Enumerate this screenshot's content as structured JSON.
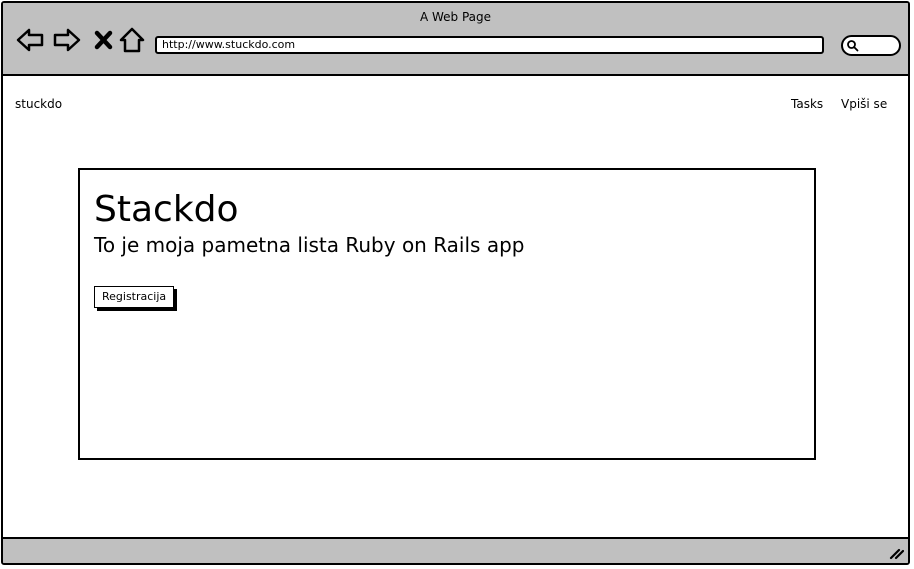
{
  "window": {
    "title": "A Web Page"
  },
  "browser": {
    "url": "http://www.stuckdo.com",
    "icons": [
      "back-arrow-icon",
      "forward-arrow-icon",
      "close-x-icon",
      "home-icon",
      "search-icon",
      "resize-grip-icon"
    ]
  },
  "navbar": {
    "brand": "stuckdo",
    "links": [
      {
        "label": "Tasks"
      },
      {
        "label": "Vpiši se"
      }
    ]
  },
  "hero": {
    "title": "Stackdo",
    "subtitle": "To je moja pametna lista Ruby on Rails app",
    "button_label": "Registracija"
  },
  "colors": {
    "chrome": "#c0c0c0",
    "border": "#000000",
    "background": "#ffffff"
  }
}
